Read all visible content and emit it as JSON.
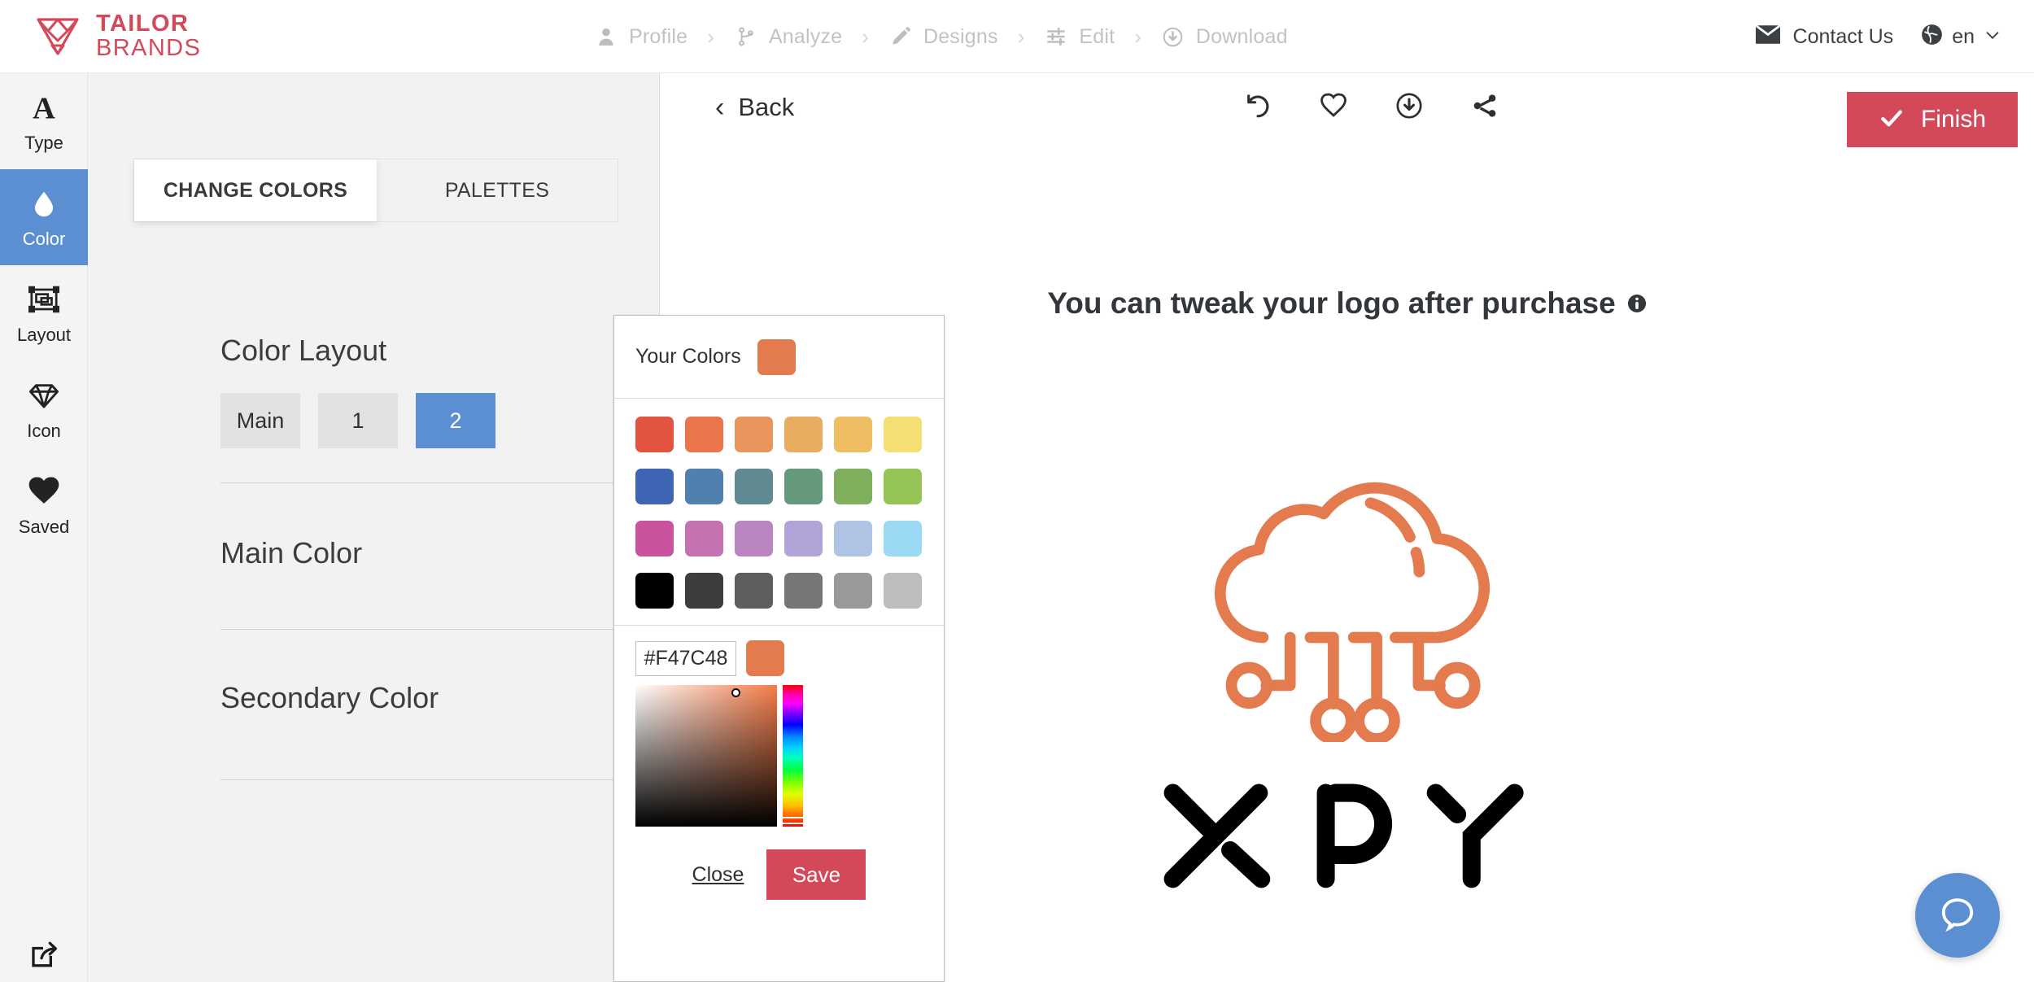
{
  "brand": {
    "line1": "TAILOR",
    "line2": "BRANDS",
    "color": "#d4495a",
    "logo_icon": "tailor-brands-heart-diamond-icon"
  },
  "topnav": {
    "steps": [
      {
        "label": "Profile",
        "icon": "user-icon"
      },
      {
        "label": "Analyze",
        "icon": "branch-icon"
      },
      {
        "label": "Designs",
        "icon": "pencil-icon"
      },
      {
        "label": "Edit",
        "icon": "sliders-icon"
      },
      {
        "label": "Download",
        "icon": "download-circle-icon"
      }
    ],
    "separator": "›",
    "contact": {
      "label": "Contact Us",
      "icon": "envelope-icon"
    },
    "language": {
      "label": "en",
      "icon": "globe-icon",
      "caret": "chevron-down-icon"
    }
  },
  "rail": {
    "items": [
      {
        "label": "Type",
        "icon": "letter-a-icon",
        "active": false
      },
      {
        "label": "Color",
        "icon": "droplet-icon",
        "active": true
      },
      {
        "label": "Layout",
        "icon": "layout-icon",
        "active": false
      },
      {
        "label": "Icon",
        "icon": "diamond-icon",
        "active": false
      },
      {
        "label": "Saved",
        "icon": "heart-icon",
        "active": false
      }
    ],
    "bottom_icon": "share-export-icon",
    "active_color": "#5b8fd1"
  },
  "panel": {
    "tabs": [
      {
        "label": "CHANGE COLORS",
        "active": true
      },
      {
        "label": "PALETTES",
        "active": false
      }
    ],
    "section_title": "Color Layout",
    "layout_options": [
      {
        "label": "Main",
        "active": false
      },
      {
        "label": "1",
        "active": false
      },
      {
        "label": "2",
        "active": true
      }
    ],
    "color_rows": [
      {
        "label": "Main Color",
        "value": "#E37B4E",
        "edit_icon": "pencil-icon"
      },
      {
        "label": "Secondary Color",
        "value": "#000000",
        "edit_icon": "pencil-icon"
      }
    ]
  },
  "picker": {
    "header_label": "Your Colors",
    "current_color": "#E37B4E",
    "swatches": [
      "#E25440",
      "#E8764A",
      "#E8955B",
      "#E9AC61",
      "#EFBE63",
      "#F5DE72",
      "#3F66B5",
      "#5080AD",
      "#5F8A91",
      "#649A7B",
      "#7FAE5C",
      "#96C355",
      "#C9539E",
      "#C472B2",
      "#BA85C0",
      "#B2A4D6",
      "#AFC3E5",
      "#9CD9F4",
      "#000000",
      "#3D3D3D",
      "#5E5E5E",
      "#767676",
      "#999999",
      "#BDBDBD"
    ],
    "hex_value": "#F47C48",
    "hex_placeholder": "#000000",
    "preview_color": "#E37B4E",
    "close_label": "Close",
    "save_label": "Save",
    "save_color": "#d4495a"
  },
  "canvas": {
    "back_label": "Back",
    "tools": [
      {
        "name": "undo-icon"
      },
      {
        "name": "heart-outline-icon"
      },
      {
        "name": "download-circle-icon"
      },
      {
        "name": "share-icon"
      }
    ],
    "finish_label": "Finish",
    "finish_icon": "check-icon",
    "finish_color": "#d4495a",
    "tweak_note": "You can tweak your logo after purchase",
    "info_icon": "info-icon",
    "logo": {
      "icon_name": "cloud-network-icon",
      "icon_color": "#E37B4E",
      "text": "XPY",
      "text_color": "#000000"
    },
    "help_icon": "chat-bubble-icon",
    "help_color": "#5b8fd1"
  }
}
